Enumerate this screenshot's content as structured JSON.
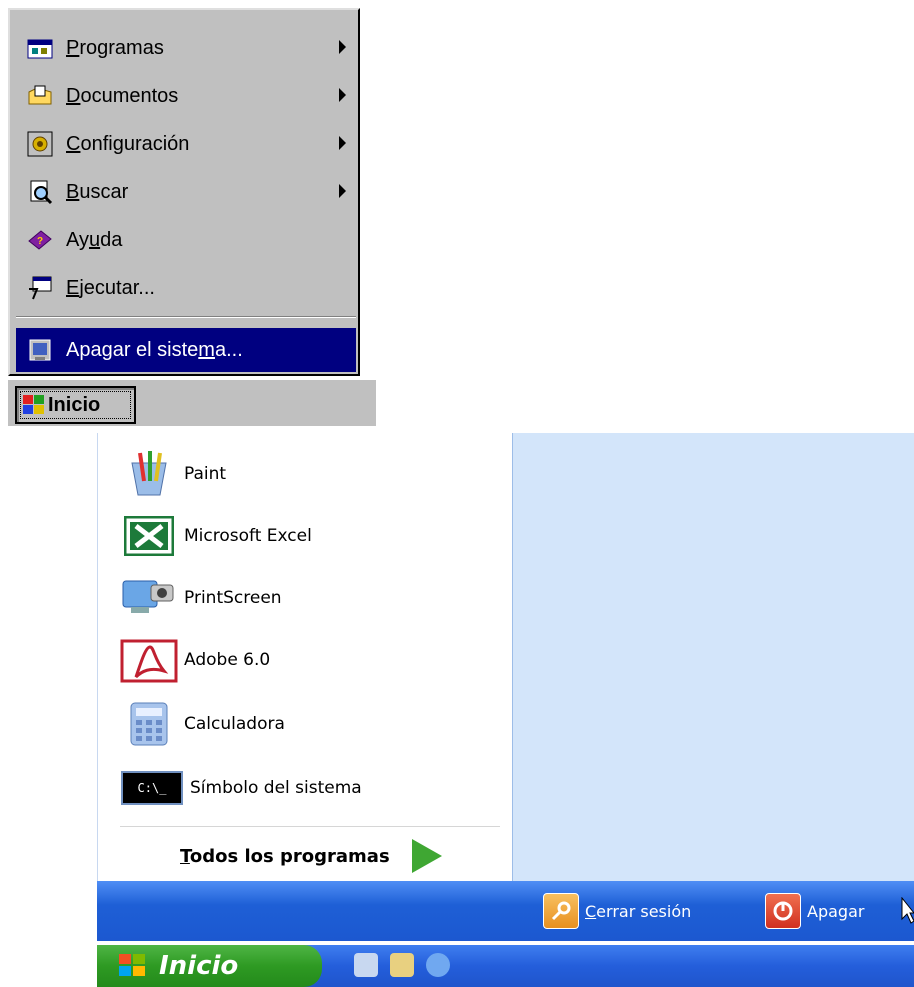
{
  "classic_menu": {
    "items": [
      {
        "label_u": "P",
        "label_rest": "rogramas",
        "icon": "programs-folder-icon",
        "submenu": true
      },
      {
        "label_u": "D",
        "label_rest": "ocumentos",
        "icon": "documents-folder-icon",
        "submenu": true
      },
      {
        "label_u": "C",
        "label_rest": "onfiguración",
        "icon": "settings-icon",
        "submenu": true
      },
      {
        "label_u": "B",
        "label_rest": "uscar",
        "icon": "search-icon",
        "submenu": true
      },
      {
        "label_pre": "Ay",
        "label_u": "u",
        "label_rest": "da",
        "icon": "help-book-icon",
        "submenu": false
      },
      {
        "label_u": "E",
        "label_rest": "jecutar...",
        "icon": "run-icon",
        "submenu": false
      }
    ],
    "shutdown": {
      "label_pre": "Apagar el siste",
      "label_u": "m",
      "label_rest": "a...",
      "icon": "shutdown-icon"
    },
    "start_label": "Inicio"
  },
  "xp_menu": {
    "pinned": [
      {
        "label": "Paint",
        "icon": "paint-icon"
      },
      {
        "label": "Microsoft Excel",
        "icon": "excel-icon"
      },
      {
        "label": "PrintScreen",
        "icon": "printscreen-icon"
      },
      {
        "label": "Adobe 6.0",
        "icon": "adobe-icon"
      },
      {
        "label": "Calculadora",
        "icon": "calculator-icon"
      },
      {
        "label": "Símbolo del sistema",
        "icon": "command-prompt-icon"
      }
    ],
    "all_programs": {
      "u": "T",
      "rest": "odos los programas"
    },
    "logoff": {
      "u": "C",
      "rest": "errar sesión"
    },
    "shutdown": {
      "pre": "Apa",
      "u": "g",
      "rest": "ar"
    },
    "start_label": "Inicio",
    "cmd_text": "C:\\_"
  }
}
